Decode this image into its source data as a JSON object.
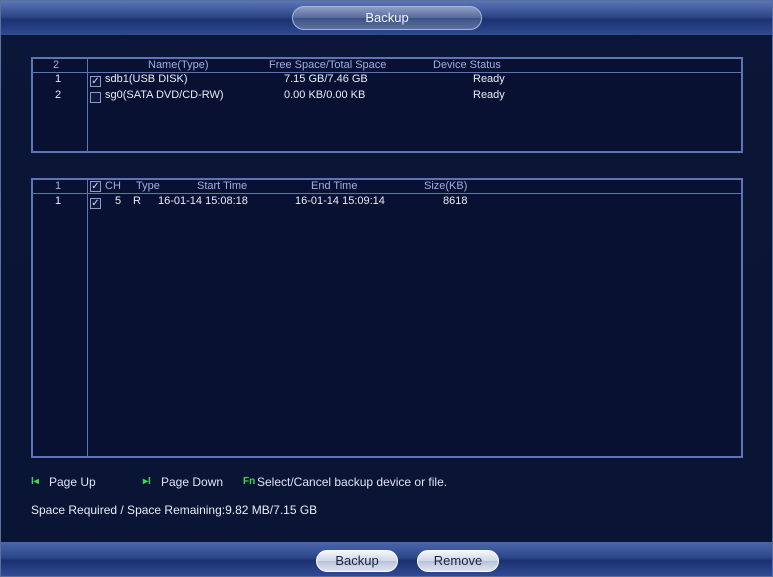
{
  "window": {
    "title": "Backup"
  },
  "devices": {
    "headers": {
      "index": "2",
      "name_type": "Name(Type)",
      "space": "Free Space/Total Space",
      "status": "Device Status"
    },
    "rows": [
      {
        "index": "1",
        "checked": true,
        "name": "sdb1(USB DISK)",
        "space": "7.15 GB/7.46 GB",
        "status": "Ready"
      },
      {
        "index": "2",
        "checked": false,
        "name": "sg0(SATA DVD/CD-RW)",
        "space": "0.00 KB/0.00 KB",
        "status": "Ready"
      }
    ]
  },
  "files": {
    "headers": {
      "index": "1",
      "ch": "CH",
      "type": "Type",
      "start": "Start Time",
      "end": "End Time",
      "size": "Size(KB)"
    },
    "header_checked": true,
    "rows": [
      {
        "index": "1",
        "checked": true,
        "ch": "5",
        "type": "R",
        "start": "16-01-14 15:08:18",
        "end": "16-01-14 15:09:14",
        "size": "8618"
      }
    ]
  },
  "help": {
    "page_up_key": "I◂",
    "page_up": "Page Up",
    "page_down_key": "▸I",
    "page_down": "Page Down",
    "fn_key": "Fn",
    "select": "Select/Cancel backup device or file."
  },
  "space_line": "Space Required / Space Remaining:9.82 MB/7.15 GB",
  "buttons": {
    "backup": "Backup",
    "remove": "Remove"
  }
}
